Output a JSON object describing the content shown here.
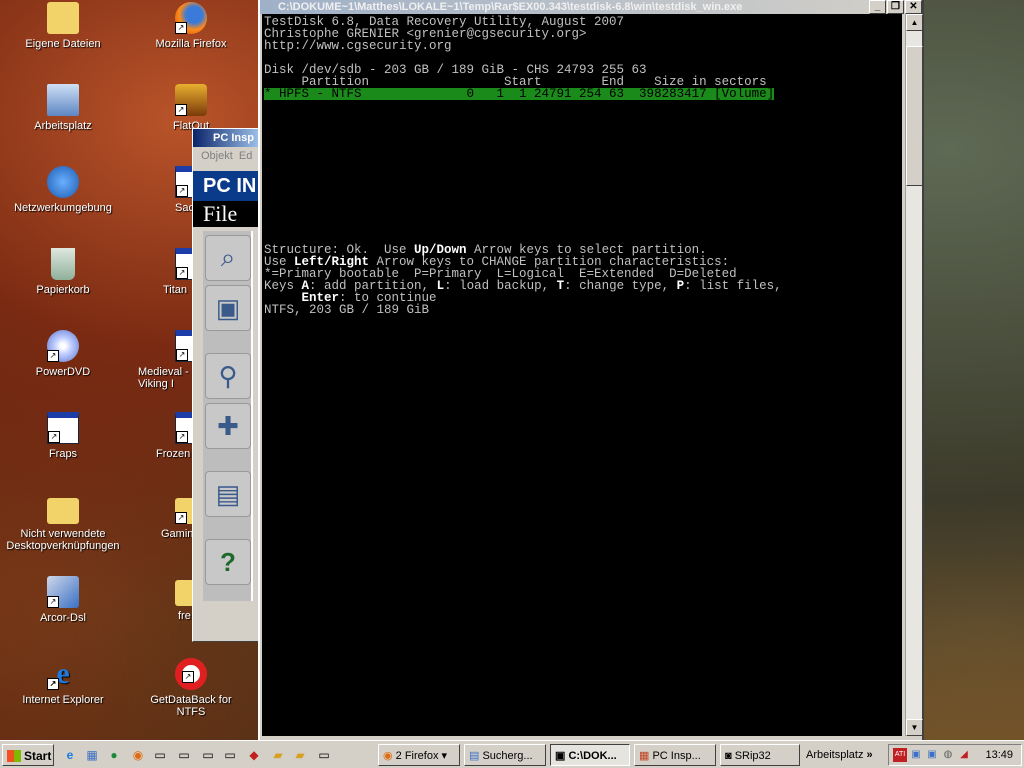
{
  "desktop": {
    "icons_left": [
      {
        "label": "Eigene Dateien",
        "icon": "folder-documents-icon"
      },
      {
        "label": "Arbeitsplatz",
        "icon": "computer-icon"
      },
      {
        "label": "Netzwerkumgebung",
        "icon": "network-icon"
      },
      {
        "label": "Papierkorb",
        "icon": "recycle-bin-icon"
      },
      {
        "label": "PowerDVD",
        "icon": "dvd-icon"
      },
      {
        "label": "Fraps",
        "icon": "app-window-icon"
      },
      {
        "label": "Nicht verwendete Desktopverknüpfungen",
        "icon": "folder-icon"
      },
      {
        "label": "Arcor-Dsl",
        "icon": "network-connection-icon"
      },
      {
        "label": "Internet Explorer",
        "icon": "ie-icon"
      }
    ],
    "icons_right": [
      {
        "label": "Mozilla Firefox",
        "icon": "firefox-icon"
      },
      {
        "label": "FlatOut",
        "icon": "game-icon"
      },
      {
        "label": "Sac",
        "icon": "app-window-icon"
      },
      {
        "label": "Titan",
        "icon": "app-window-icon"
      },
      {
        "label": "Medieval - Viking I",
        "icon": "app-window-icon"
      },
      {
        "label": "Frozen",
        "icon": "app-window-icon"
      },
      {
        "label": "Gamin",
        "icon": "folder-icon"
      },
      {
        "label": "fre",
        "icon": "folder-icon"
      },
      {
        "label": "GetDataBack for NTFS",
        "icon": "lifebuoy-icon"
      }
    ]
  },
  "pc_inspector": {
    "title": "PC Insp",
    "menu": [
      "Objekt",
      "Ed"
    ],
    "brand": "PC IN",
    "file_label": "File"
  },
  "console": {
    "title": "C:\\DOKUME~1\\Matthes\\LOKALE~1\\Temp\\Rar$EX00.343\\testdisk-6.8\\win\\testdisk_win.exe",
    "lines": {
      "l1": "TestDisk 6.8, Data Recovery Utility, August 2007",
      "l2": "Christophe GRENIER <grenier@cgsecurity.org>",
      "l3": "http://www.cgsecurity.org",
      "disk": "Disk /dev/sdb - 203 GB / 189 GiB - CHS 24793 255 63",
      "header": "     Partition                  Start        End    Size in sectors",
      "partition": "* HPFS - NTFS              0   1  1 24791 254 63  398283417 [Volume]",
      "s1": "Structure: Ok.  Use ",
      "s1b": "Up/Down",
      "s1c": " Arrow keys to select partition.",
      "s2": "Use ",
      "s2b": "Left/Right",
      "s2c": " Arrow keys to CHANGE partition characteristics:",
      "s3": "*=Primary bootable  P=Primary  L=Logical  E=Extended  D=Deleted",
      "s4": "Keys ",
      "s4a": "A",
      "s4b": ": add partition, ",
      "s4c": "L",
      "s4d": ": load backup, ",
      "s4e": "T",
      "s4f": ": change type, ",
      "s4g": "P",
      "s4h": ": list files,",
      "s5a": "     Enter",
      "s5b": ": to continue",
      "s6": "NTFS, 203 GB / 189 GiB"
    }
  },
  "taskbar": {
    "start": "Start",
    "tasks": [
      {
        "label": "2 Firefox",
        "icon": "firefox-icon"
      },
      {
        "label": "Sucherg...",
        "icon": "search-doc-icon"
      },
      {
        "label": "C:\\DOK...",
        "icon": "console-icon"
      },
      {
        "label": "PC Insp...",
        "icon": "pc-inspector-icon"
      },
      {
        "label": "SRip32",
        "icon": "camera-icon"
      }
    ],
    "arbeitsplatz": "Arbeitsplatz",
    "clock": "13:49"
  }
}
